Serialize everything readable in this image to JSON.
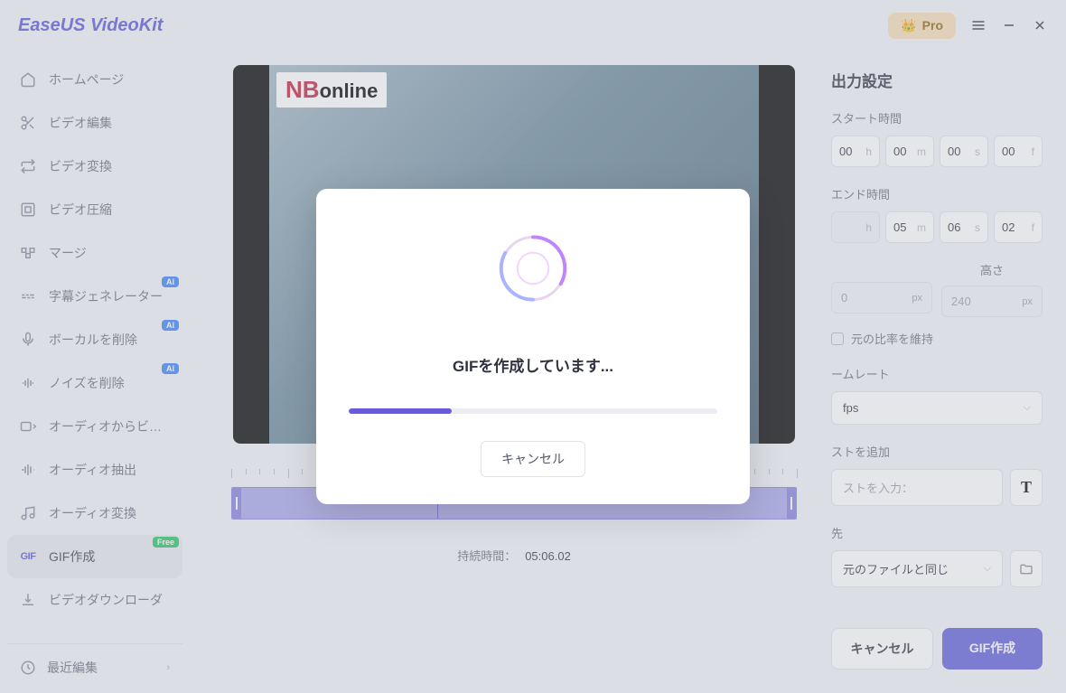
{
  "app_title": "EaseUS VideoKit",
  "pro_label": "Pro",
  "sidebar": {
    "items": [
      {
        "label": "ホームページ"
      },
      {
        "label": "ビデオ編集"
      },
      {
        "label": "ビデオ変換"
      },
      {
        "label": "ビデオ圧縮"
      },
      {
        "label": "マージ"
      },
      {
        "label": "字幕ジェネレーター",
        "badge": "AI"
      },
      {
        "label": "ボーカルを削除",
        "badge": "AI"
      },
      {
        "label": "ノイズを削除",
        "badge": "AI"
      },
      {
        "label": "オーディオからビ…"
      },
      {
        "label": "オーディオ抽出"
      },
      {
        "label": "オーディオ変換"
      },
      {
        "label": "GIF作成",
        "badge": "Free"
      },
      {
        "label": "ビデオダウンローダ"
      }
    ],
    "recent": "最近編集"
  },
  "preview_logo": {
    "nb": "NB",
    "rest": "online"
  },
  "duration_label": "持続時間：",
  "duration_value": "05:06.02",
  "panel": {
    "title": "出力設定",
    "start_label": "スタート時間",
    "end_label": "エンド時間",
    "start": {
      "h": "00",
      "m": "00",
      "s": "00",
      "f": "00"
    },
    "end": {
      "h": "",
      "m": "05",
      "s": "06",
      "f": "02"
    },
    "units": {
      "h": "h",
      "m": "m",
      "s": "s",
      "f": "f"
    },
    "height_label": "高さ",
    "width_val": "0",
    "height_val": "240",
    "px": "px",
    "keep_ratio": "元の比率を維持",
    "framerate_label": "ームレート",
    "framerate_val": "fps",
    "add_text_label": "ストを追加",
    "text_placeholder": "ストを入力：",
    "save_label": "先",
    "save_value": "元のファイルと同じ",
    "cancel": "キャンセル",
    "create": "GIF作成"
  },
  "modal": {
    "message": "GIFを作成しています...",
    "cancel": "キャンセル"
  }
}
